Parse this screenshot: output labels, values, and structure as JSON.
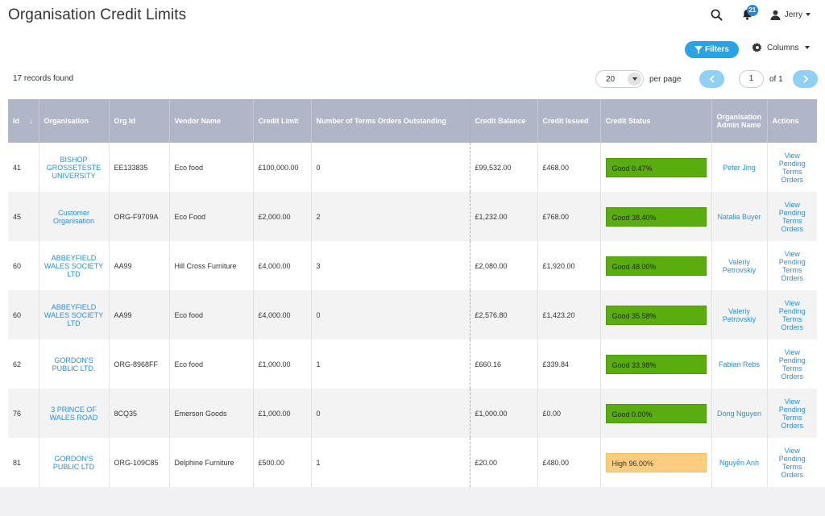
{
  "page_title": "Organisation Credit Limits",
  "header": {
    "notification_count": "21",
    "user_name": "Jerry"
  },
  "toolbar": {
    "filters_label": "Filters",
    "columns_label": "Columns"
  },
  "records_found": "17 records found",
  "pagination": {
    "per_page_value": "20",
    "per_page_label": "per page",
    "current_page": "1",
    "of_label": "of 1"
  },
  "table": {
    "columns": [
      "Id",
      "Organisation",
      "Org Id",
      "Vendor Name",
      "Credit Limit",
      "Number of Terms Orders Outstanding",
      "Credit Balance",
      "Credit Issued",
      "Credit Status",
      "Organisation Admin Name",
      "Actions"
    ],
    "sort_indicator": "↓",
    "action_label": "View Pending Terms Orders",
    "rows": [
      {
        "id": "41",
        "organisation": "BISHOP GROSSETESTE UNIVERSITY",
        "org_id": "EE133835",
        "vendor": "Eco food",
        "credit_limit": "£100,000.00",
        "terms_outstanding": "0",
        "credit_balance": "£99,532.00",
        "credit_issued": "£468.00",
        "status": "Good 0.47%",
        "status_level": "good",
        "admin": "Peter Jing"
      },
      {
        "id": "45",
        "organisation": "Customer Organisation",
        "org_id": "ORG-F9709A",
        "vendor": "Eco Food",
        "credit_limit": "£2,000.00",
        "terms_outstanding": "2",
        "credit_balance": "£1,232.00",
        "credit_issued": "£768.00",
        "status": "Good 38.40%",
        "status_level": "good",
        "admin": "Natalia Buyer"
      },
      {
        "id": "60",
        "organisation": "ABBEYFIELD WALES SOCIETY LTD",
        "org_id": "AA99",
        "vendor": "Hill Cross Furniture",
        "credit_limit": "£4,000.00",
        "terms_outstanding": "3",
        "credit_balance": "£2,080.00",
        "credit_issued": "£1,920.00",
        "status": "Good 48.00%",
        "status_level": "good",
        "admin": "Valeriy Petrovskiy"
      },
      {
        "id": "60",
        "organisation": "ABBEYFIELD WALES SOCIETY LTD",
        "org_id": "AA99",
        "vendor": "Eco food",
        "credit_limit": "£4,000.00",
        "terms_outstanding": "0",
        "credit_balance": "£2,576.80",
        "credit_issued": "£1,423.20",
        "status": "Good 35.58%",
        "status_level": "good",
        "admin": "Valeriy Petrovskiy"
      },
      {
        "id": "62",
        "organisation": "GORDON'S PUBLIC LTD.",
        "org_id": "ORG-8968FF",
        "vendor": "Eco food",
        "credit_limit": "£1,000.00",
        "terms_outstanding": "1",
        "credit_balance": "£660.16",
        "credit_issued": "£339.84",
        "status": "Good 33.98%",
        "status_level": "good",
        "admin": "Fabian Rebs"
      },
      {
        "id": "76",
        "organisation": "3 PRINCE OF WALES ROAD",
        "org_id": "8CQ35",
        "vendor": "Emerson Goods",
        "credit_limit": "£1,000.00",
        "terms_outstanding": "0",
        "credit_balance": "£1,000.00",
        "credit_issued": "£0.00",
        "status": "Good 0.00%",
        "status_level": "good",
        "admin": "Dong Nguyen"
      },
      {
        "id": "81",
        "organisation": "GORDON'S PUBLIC LTD",
        "org_id": "ORG-109C85",
        "vendor": "Delphine Furniture",
        "credit_limit": "£500.00",
        "terms_outstanding": "1",
        "credit_balance": "£20.00",
        "credit_issued": "£480.00",
        "status": "High 96.00%",
        "status_level": "high",
        "admin": "Nguyễn Anh"
      }
    ]
  },
  "colors": {
    "accent": "#29a3e6",
    "header_bg": "#b0b5c8",
    "status_good": "#5aad0e",
    "status_high": "#fdcd7f",
    "link": "#2a8fd8"
  }
}
